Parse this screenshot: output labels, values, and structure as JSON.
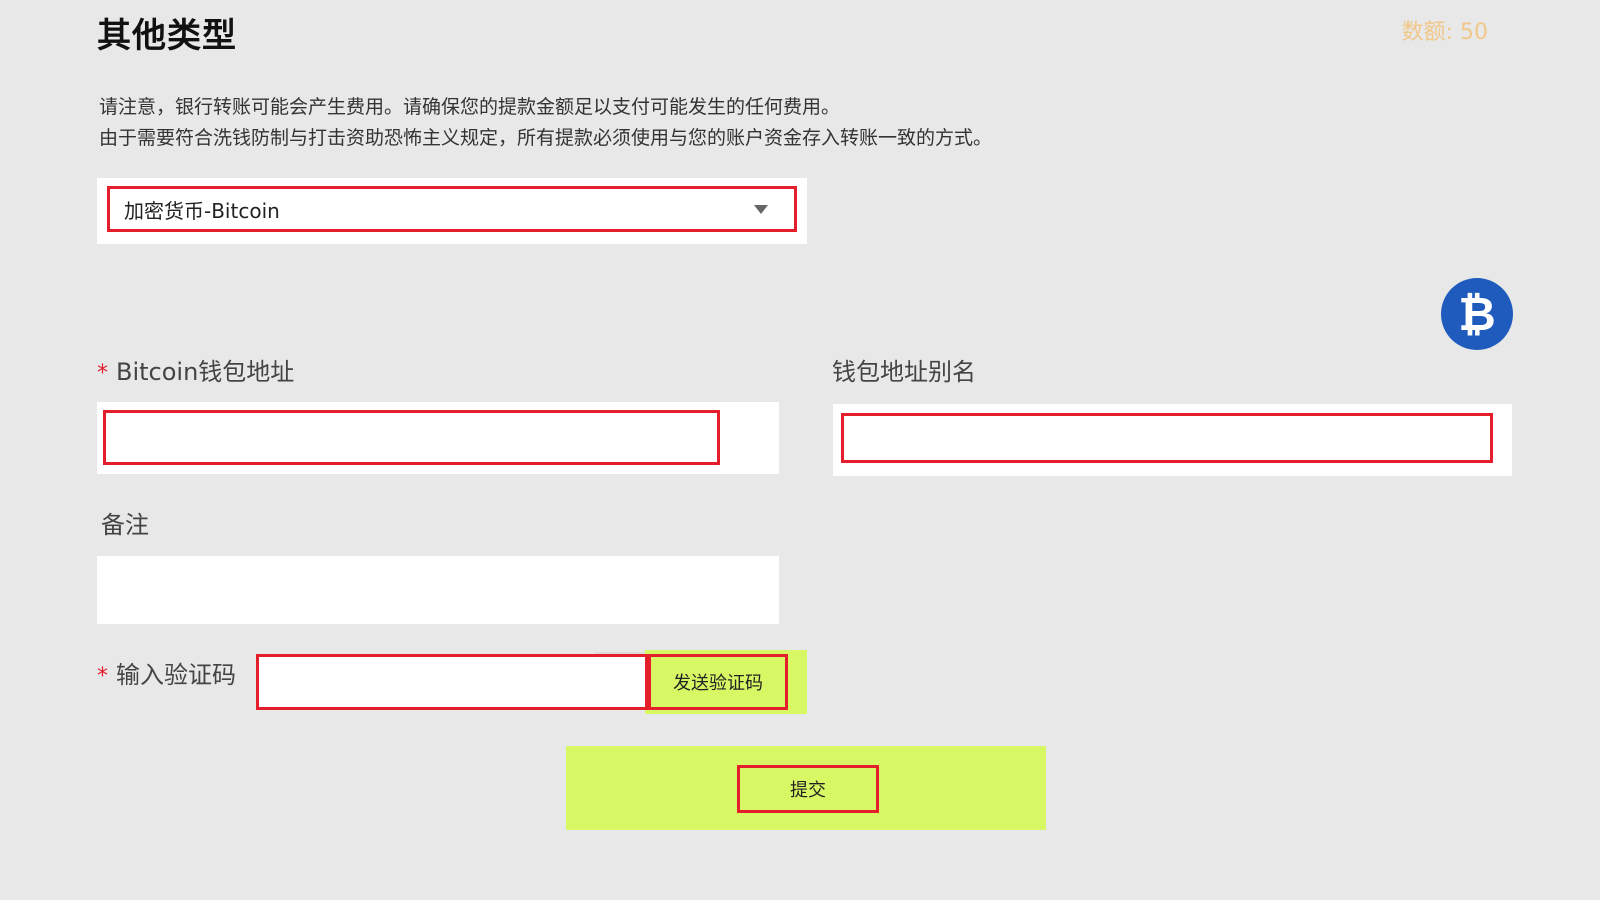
{
  "header": {
    "title": "其他类型",
    "balance": "数额: 50"
  },
  "notice": {
    "line1": "请注意，银行转账可能会产生费用。请确保您的提款金额足以支付可能发生的任何费用。",
    "line2": "由于需要符合洗钱防制与打击资助恐怖主义规定，所有提款必须使用与您的账户资金存入转账一致的方式。"
  },
  "method_select": {
    "selected": "加密货币-Bitcoin"
  },
  "icons": {
    "coin": "bitcoin-icon",
    "coin_symbol": "₿"
  },
  "form": {
    "required_mark": "*",
    "wallet_address": {
      "label": "Bitcoin钱包地址",
      "value": "",
      "placeholder": ""
    },
    "wallet_alias": {
      "label": "钱包地址别名",
      "value": "",
      "placeholder": ""
    },
    "remark": {
      "label": "备注",
      "value": "",
      "placeholder": ""
    },
    "verification": {
      "label": "输入验证码",
      "value": "",
      "placeholder": "",
      "send_label": "发送验证码"
    },
    "submit_label": "提交"
  },
  "colors": {
    "highlight_red": "#e41e2b",
    "accent_green": "#d8f765",
    "balance_gold": "#f1c889",
    "bitcoin_blue": "#1f5bbd"
  }
}
